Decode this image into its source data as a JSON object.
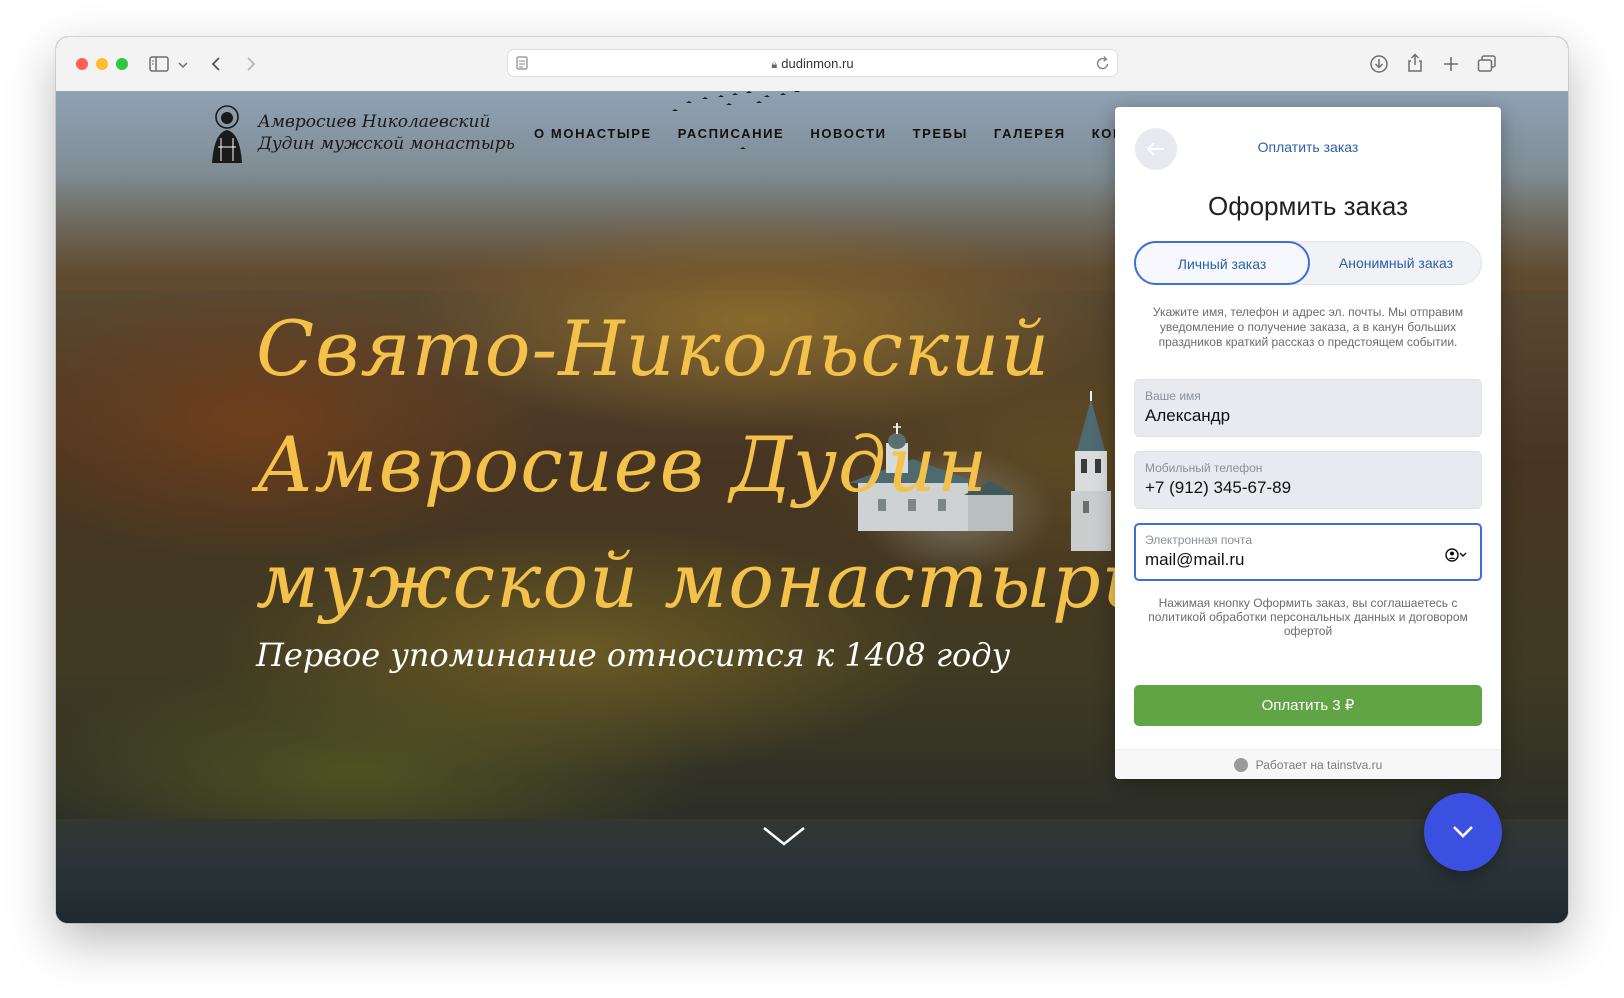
{
  "browser": {
    "url": "dudinmon.ru",
    "icons": {
      "sidebar": "sidebar-icon",
      "sidebar_dropdown": "chevron-down-icon",
      "back": "chevron-left-icon",
      "forward": "chevron-right-icon",
      "reader": "reader-icon",
      "lock": "lock-icon",
      "reload": "reload-icon",
      "download": "download-icon",
      "share": "share-icon",
      "new_tab": "plus-icon",
      "tabs": "tabs-overview-icon"
    }
  },
  "site": {
    "logo": {
      "line1": "Амвросиев Николаевский",
      "line2": "Дудин мужской монастырь"
    },
    "nav": [
      "О МОНАСТЫРЕ",
      "РАСПИСАНИЕ",
      "НОВОСТИ",
      "ТРЕБЫ",
      "ГАЛЕРЕЯ",
      "КОН"
    ],
    "hero": {
      "line1": "Свято-Никольский",
      "line2": "Амвросиев Дудин",
      "line3": "мужской монастырь",
      "subtitle": "Первое упоминание относится к 1408 году"
    },
    "colors": {
      "hero_title": "#f4c24a",
      "fab": "#3b50e0"
    }
  },
  "order_panel": {
    "header": "Оплатить заказ",
    "title": "Оформить заказ",
    "tabs": [
      {
        "label": "Личный заказ",
        "active": true
      },
      {
        "label": "Анонимный заказ",
        "active": false
      }
    ],
    "description": "Укажите имя, телефон и адрес эл. почты. Мы отправим уведомление о получение заказа, а в канун больших праздников краткий рассказ о предстоящем событии.",
    "fields": {
      "name": {
        "label": "Ваше имя",
        "value": "Александр"
      },
      "phone": {
        "label": "Мобильный телефон",
        "value": "+7 (912) 345-67-89"
      },
      "email": {
        "label": "Электронная почта",
        "value": "mail@mail.ru"
      }
    },
    "consent": "Нажимая кнопку Оформить заказ, вы соглашаетесь с политикой обработки персональных данных и договором офертой",
    "pay_button": "Оплатить 3 ₽",
    "powered_by": "Работает на tainstva.ru",
    "colors": {
      "accent": "#3d6fd6",
      "link": "#2b5fa8",
      "pay": "#60a445"
    }
  }
}
